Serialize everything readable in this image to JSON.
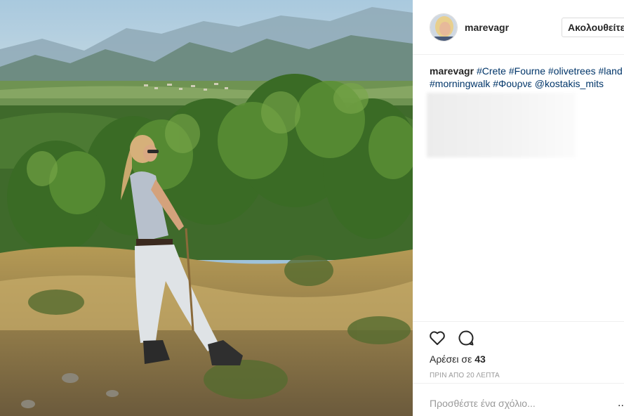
{
  "post": {
    "username": "marevagr",
    "follow_label": "Ακολουθείτε",
    "caption": {
      "user": "marevagr",
      "hashtags": [
        "#Crete",
        "#Fourne",
        "#olivetrees",
        "#land",
        "#morningwalk",
        "#Φουρνε"
      ],
      "mention": "@kostakis_mits"
    },
    "likes_prefix": "Αρέσει σε",
    "likes_count": "43",
    "timestamp": "ΠΡΙΝ ΑΠΟ 20 ΛΕΠΤΑ",
    "comment_placeholder": "Προσθέστε ένα σχόλιο...",
    "more_label": "..."
  },
  "icons": {
    "like": "heart-outline-icon",
    "comment": "speech-bubble-icon",
    "more": "more-options-icon"
  },
  "colors": {
    "hashtag_link": "#003569",
    "primary_text": "#262626",
    "muted_text": "#999999",
    "divider": "#efefef"
  }
}
